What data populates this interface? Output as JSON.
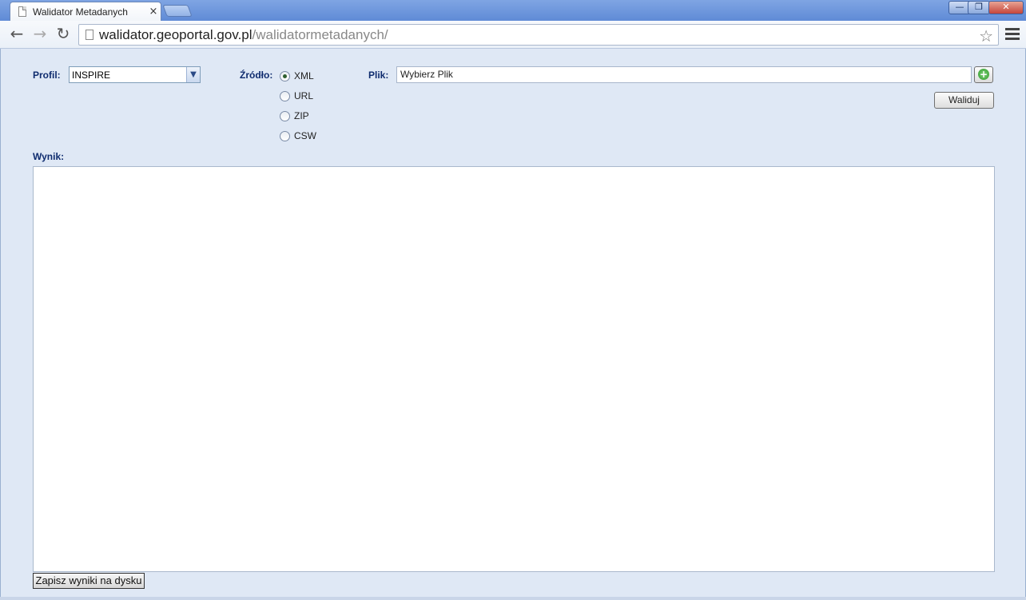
{
  "browser": {
    "tab_title": "Walidator Metadanych",
    "tab_close": "×",
    "url_host": "walidator.geoportal.gov.pl",
    "url_path": "/walidatormetadanych/",
    "win_min": "—",
    "win_max": "❐",
    "win_close": "✕"
  },
  "form": {
    "profil_label": "Profil:",
    "profil_value": "INSPIRE",
    "zrodlo_label": "Źródło:",
    "sources": [
      {
        "label": "XML",
        "checked": true
      },
      {
        "label": "URL",
        "checked": false
      },
      {
        "label": "ZIP",
        "checked": false
      },
      {
        "label": "CSW",
        "checked": false
      }
    ],
    "plik_label": "Plik:",
    "plik_value": "Wybierz Plik",
    "validate_label": "Waliduj",
    "wynik_label": "Wynik:",
    "save_label": "Zapisz wyniki na dysku"
  }
}
